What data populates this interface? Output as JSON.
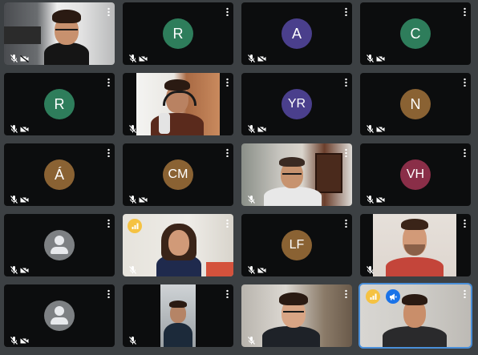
{
  "meeting": {
    "tiles": [
      {
        "kind": "video",
        "name": "participant-1"
      },
      {
        "kind": "avatar",
        "initials": "R",
        "color": "#2e7d5b"
      },
      {
        "kind": "avatar",
        "initials": "A",
        "color": "#4a3f8c"
      },
      {
        "kind": "avatar",
        "initials": "C",
        "color": "#2e7d5b"
      },
      {
        "kind": "avatar",
        "initials": "R",
        "color": "#2e7d5b"
      },
      {
        "kind": "video",
        "name": "participant-6"
      },
      {
        "kind": "avatar",
        "initials": "YR",
        "color": "#4a3f8c"
      },
      {
        "kind": "avatar",
        "initials": "N",
        "color": "#8a6233"
      },
      {
        "kind": "avatar",
        "initials": "Á",
        "color": "#8a6233"
      },
      {
        "kind": "avatar",
        "initials": "CM",
        "color": "#8a6233"
      },
      {
        "kind": "video",
        "name": "participant-11"
      },
      {
        "kind": "avatar",
        "initials": "VH",
        "color": "#8a2e48"
      },
      {
        "kind": "placeholder"
      },
      {
        "kind": "video",
        "name": "participant-14"
      },
      {
        "kind": "avatar",
        "initials": "LF",
        "color": "#8a6233"
      },
      {
        "kind": "video",
        "name": "participant-16"
      },
      {
        "kind": "placeholder"
      },
      {
        "kind": "video",
        "name": "participant-18"
      },
      {
        "kind": "video",
        "name": "participant-19"
      },
      {
        "kind": "video",
        "name": "participant-20"
      }
    ],
    "colors": {
      "background": "#3c4043",
      "tile": "#0c0d0e",
      "active_outline": "#4a8fd9",
      "signal_badge": "#f5c242",
      "speaker_badge": "#1a73e8"
    },
    "icons": [
      "mic-off-icon",
      "camera-off-icon",
      "more-options-icon",
      "signal-icon",
      "megaphone-icon",
      "person-icon"
    ]
  }
}
